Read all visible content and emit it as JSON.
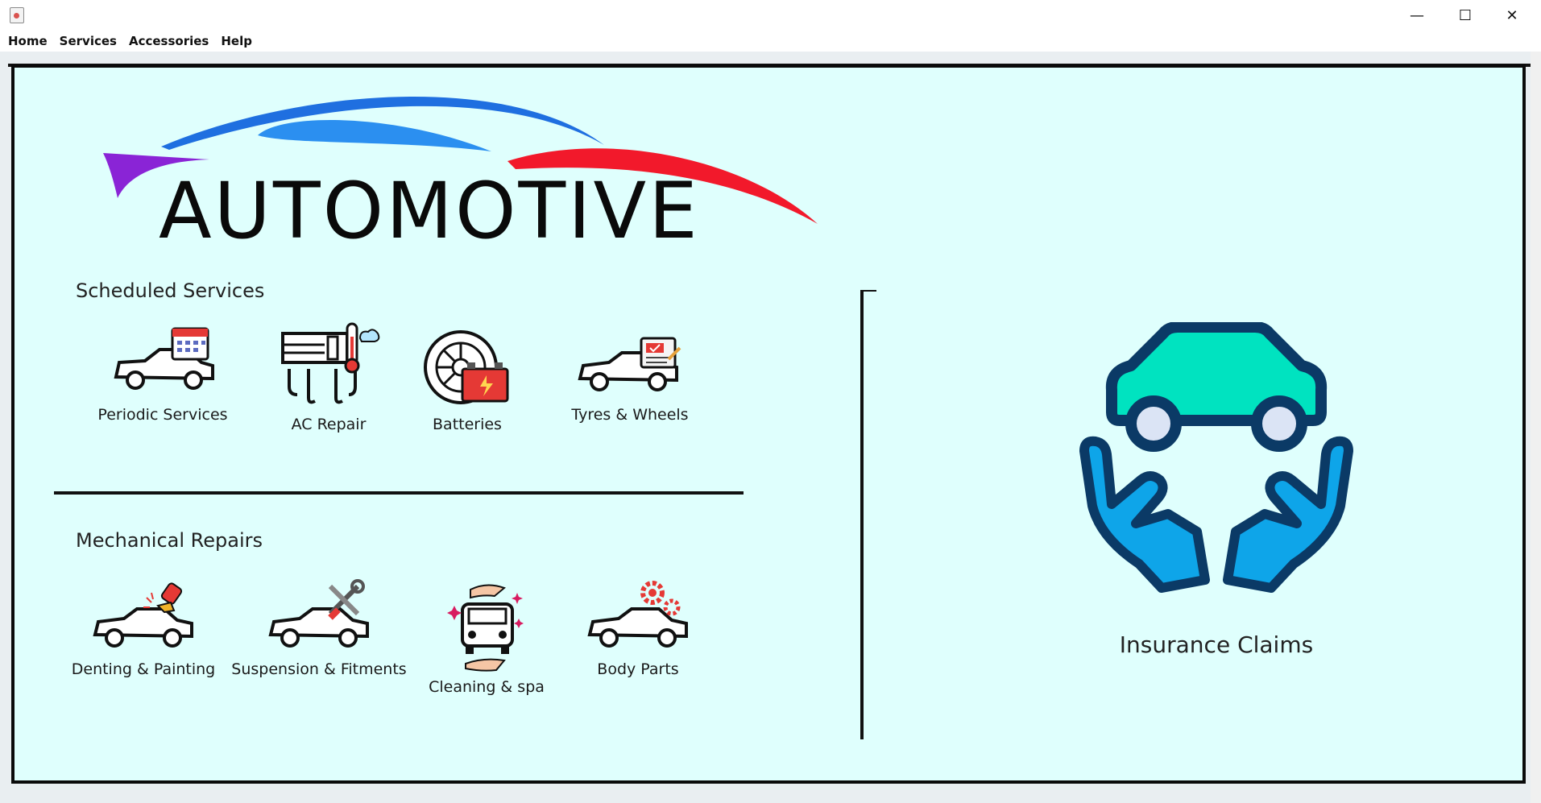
{
  "window": {
    "minimize_glyph": "—",
    "maximize_glyph": "☐",
    "close_glyph": "✕"
  },
  "menu": [
    "Home",
    "Services",
    "Accessories",
    "Help"
  ],
  "logo": {
    "text": "AUTOMOTIVE"
  },
  "scheduled": {
    "title": "Scheduled Services",
    "items": [
      {
        "label": "Periodic Services",
        "icon": "car-calendar-icon"
      },
      {
        "label": "AC Repair",
        "icon": "ac-thermometer-icon"
      },
      {
        "label": "Batteries",
        "icon": "tire-battery-icon"
      },
      {
        "label": "Tyres & Wheels",
        "icon": "car-checklist-icon"
      }
    ]
  },
  "mechanical": {
    "title": "Mechanical Repairs",
    "items": [
      {
        "label": "Denting & Painting",
        "icon": "car-spray-gun-icon"
      },
      {
        "label": "Suspension & Fitments",
        "icon": "car-wrench-icon"
      },
      {
        "label": "Cleaning & spa",
        "icon": "car-hands-clean-icon"
      },
      {
        "label": "Body Parts",
        "icon": "car-gears-icon"
      }
    ]
  },
  "insurance": {
    "label": "Insurance Claims",
    "icon": "car-hands-insurance-icon"
  },
  "colors": {
    "panel_bg": "#dffffd",
    "logo_blue": "#1f6fe0",
    "logo_red": "#f2192b",
    "logo_purple": "#8a24d6",
    "insurance_car": "#00e3c0",
    "insurance_hands": "#0ea5e9",
    "insurance_outline": "#0b3a66"
  }
}
